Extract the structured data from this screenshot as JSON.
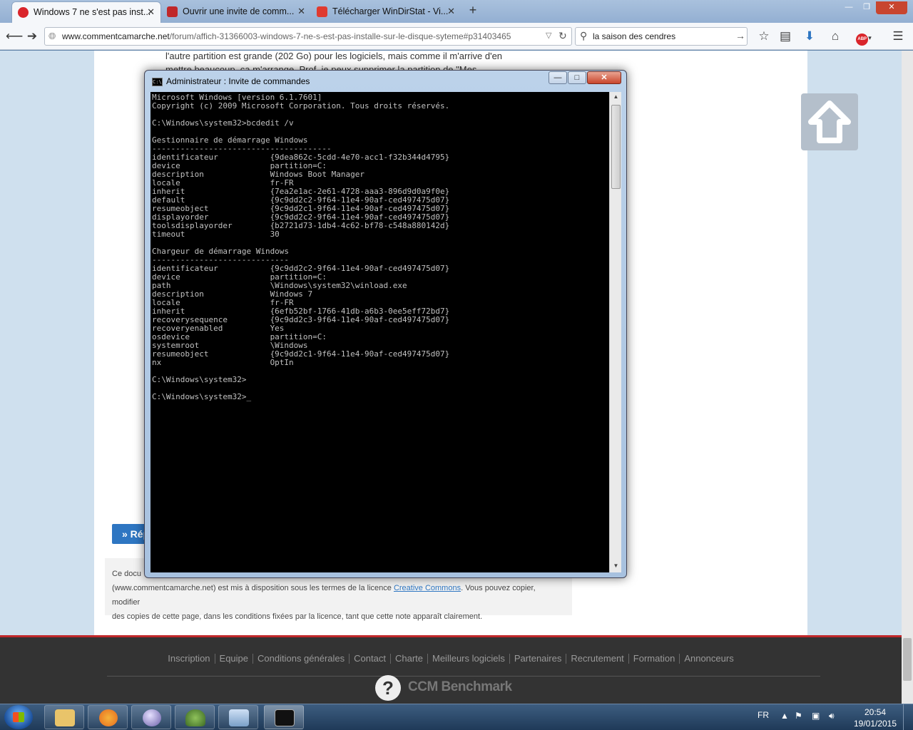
{
  "browser": {
    "tabs": [
      {
        "label": "Windows 7 ne s'est pas inst...",
        "active": true,
        "favicon_color": "#d9252b"
      },
      {
        "label": "Ouvrir une invite de comm...",
        "active": false,
        "favicon_color": "#c0282a"
      },
      {
        "label": "Télécharger WinDirStat - Vi...",
        "active": false,
        "favicon_color": "#e03a2f"
      }
    ],
    "new_tab": "+",
    "url_host": "www.commentcamarche.net",
    "url_path": "/forum/affich-31366003-windows-7-ne-s-est-pas-installe-sur-le-disque-syteme#p31403465",
    "search_value": "la saison des cendres",
    "icons": {
      "back": "back-arrow-icon",
      "forward": "forward-arrow-icon",
      "reload": "reload-icon",
      "bookmark": "star-icon",
      "reading": "clipboard-icon",
      "download": "download-arrow-icon",
      "home": "home-icon",
      "adblock": "adblock-icon",
      "menu": "hamburger-menu-icon"
    }
  },
  "page": {
    "line1": "l'autre partition est grande (202 Go) pour les logiciels, mais comme il m'arrive d'en",
    "line2": "mettre beaucoup, ça m'arrange. Prof. je peux supprimer la partition de \"Mes",
    "reply_label": "» Rép",
    "license_start": "Ce docu",
    "license_line2a": "(www.commentcamarche.net) est mis à disposition sous les termes de la licence ",
    "license_link": "Creative Commons",
    "license_line2b": ". Vous pouvez copier, modifier",
    "license_line3": "des copies de cette page, dans les conditions fixées par la licence, tant que cette note apparaît clairement.",
    "footer_links": [
      "Inscription",
      "Equipe",
      "Conditions générales",
      "Contact",
      "Charte",
      "Meilleurs logiciels",
      "Partenaires",
      "Recrutement",
      "Formation",
      "Annonceurs"
    ],
    "brand": "CCM Benchmark",
    "brand_logo": "?",
    "accent": "#2e76c2",
    "footer_bar": "#c0282a"
  },
  "cmd": {
    "title": "Administrateur : Invite de commandes",
    "icon_text": "C:\\",
    "buttons": {
      "minimize": "—",
      "maximize": "□",
      "close": "✕"
    },
    "console": "Microsoft Windows [version 6.1.7601]\nCopyright (c) 2009 Microsoft Corporation. Tous droits réservés.\n\nC:\\Windows\\system32>bcdedit /v\n\nGestionnaire de démarrage Windows\n--------------------------------------\nidentificateur           {9dea862c-5cdd-4e70-acc1-f32b344d4795}\ndevice                   partition=C:\ndescription              Windows Boot Manager\nlocale                   fr-FR\ninherit                  {7ea2e1ac-2e61-4728-aaa3-896d9d0a9f0e}\ndefault                  {9c9dd2c2-9f64-11e4-90af-ced497475d07}\nresumeobject             {9c9dd2c1-9f64-11e4-90af-ced497475d07}\ndisplayorder             {9c9dd2c2-9f64-11e4-90af-ced497475d07}\ntoolsdisplayorder        {b2721d73-1db4-4c62-bf78-c548a880142d}\ntimeout                  30\n\nChargeur de démarrage Windows\n-----------------------------\nidentificateur           {9c9dd2c2-9f64-11e4-90af-ced497475d07}\ndevice                   partition=C:\npath                     \\Windows\\system32\\winload.exe\ndescription              Windows 7\nlocale                   fr-FR\ninherit                  {6efb52bf-1766-41db-a6b3-0ee5eff72bd7}\nrecoverysequence         {9c9dd2c3-9f64-11e4-90af-ced497475d07}\nrecoveryenabled          Yes\nosdevice                 partition=C:\nsystemroot               \\Windows\nresumeobject             {9c9dd2c1-9f64-11e4-90af-ced497475d07}\nnx                       OptIn\n\nC:\\Windows\\system32>\n\nC:\\Windows\\system32>_"
  },
  "taskbar": {
    "apps": [
      {
        "name": "explorer",
        "color": "#e9c46a"
      },
      {
        "name": "firefox",
        "color": "#e66a1f"
      },
      {
        "name": "app-sphere",
        "color": "#9a90c8"
      },
      {
        "name": "app-tree",
        "color": "#5c8a3a"
      },
      {
        "name": "app-network",
        "color": "#7aa0c8"
      },
      {
        "name": "cmd",
        "color": "#111111"
      }
    ],
    "lang": "FR",
    "time": "20:54",
    "date": "19/01/2015"
  }
}
